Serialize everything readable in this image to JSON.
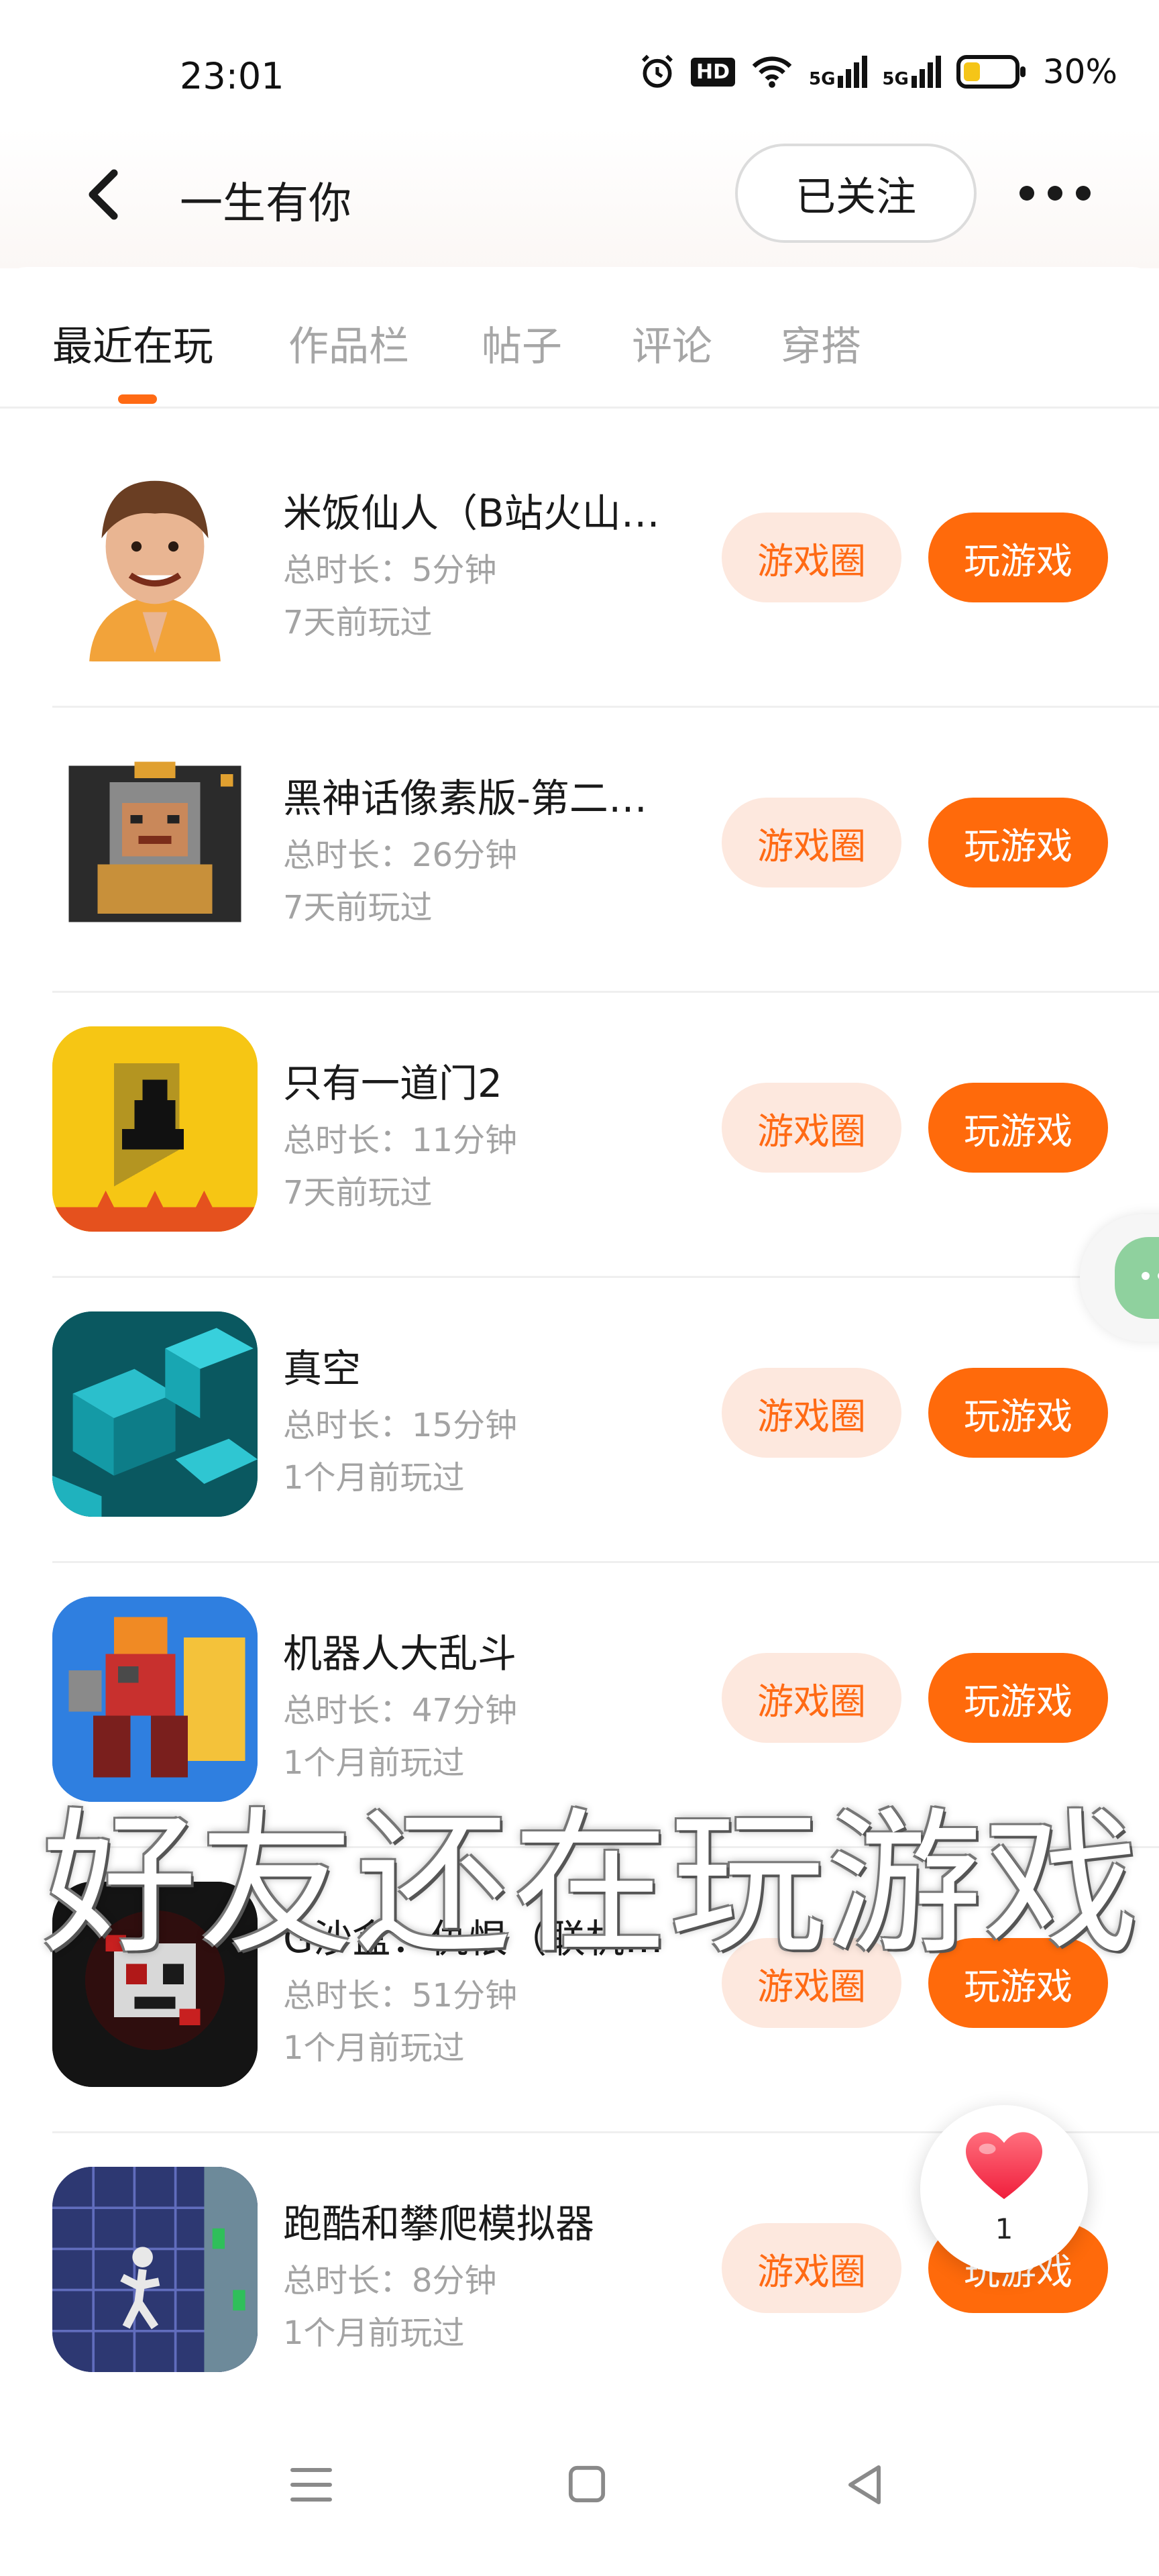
{
  "status_bar": {
    "time": "23:01",
    "battery_percent": "30%",
    "hd_badge": "HD",
    "signal_1": "5G",
    "signal_2": "5G"
  },
  "header": {
    "title": "一生有你",
    "follow_label": "已关注"
  },
  "tabs": [
    {
      "label": "最近在玩",
      "active": true
    },
    {
      "label": "作品栏",
      "active": false
    },
    {
      "label": "帖子",
      "active": false
    },
    {
      "label": "评论",
      "active": false
    },
    {
      "label": "穿搭",
      "active": false
    }
  ],
  "games": [
    {
      "name": "米饭仙人（B站火山…",
      "duration": "总时长：5分钟",
      "last_played": "7天前玩过",
      "circle_label": "游戏圈",
      "play_label": "玩游戏"
    },
    {
      "name": "黑神话像素版-第二章…",
      "duration": "总时长：26分钟",
      "last_played": "7天前玩过",
      "circle_label": "游戏圈",
      "play_label": "玩游戏"
    },
    {
      "name": "只有一道门2",
      "duration": "总时长：11分钟",
      "last_played": "7天前玩过",
      "circle_label": "游戏圈",
      "play_label": "玩游戏"
    },
    {
      "name": "真空",
      "duration": "总时长：15分钟",
      "last_played": "1个月前玩过",
      "circle_label": "游戏圈",
      "play_label": "玩游戏"
    },
    {
      "name": "机器人大乱斗",
      "duration": "总时长：47分钟",
      "last_played": "1个月前玩过",
      "circle_label": "游戏圈",
      "play_label": "玩游戏"
    },
    {
      "name": "G沙盒：仇恨（联机…",
      "duration": "总时长：51分钟",
      "last_played": "1个月前玩过",
      "circle_label": "游戏圈",
      "play_label": "玩游戏"
    },
    {
      "name": "跑酷和攀爬模拟器",
      "duration": "总时长：8分钟",
      "last_played": "1个月前玩过",
      "circle_label": "游戏圈",
      "play_label": "玩游戏"
    }
  ],
  "overlay_caption": "好友还在玩游戏",
  "like_widget": {
    "count": "1"
  },
  "colors": {
    "accent": "#ff6a0b",
    "accent_soft": "#fde8de",
    "muted_text": "#a3a3a3"
  }
}
